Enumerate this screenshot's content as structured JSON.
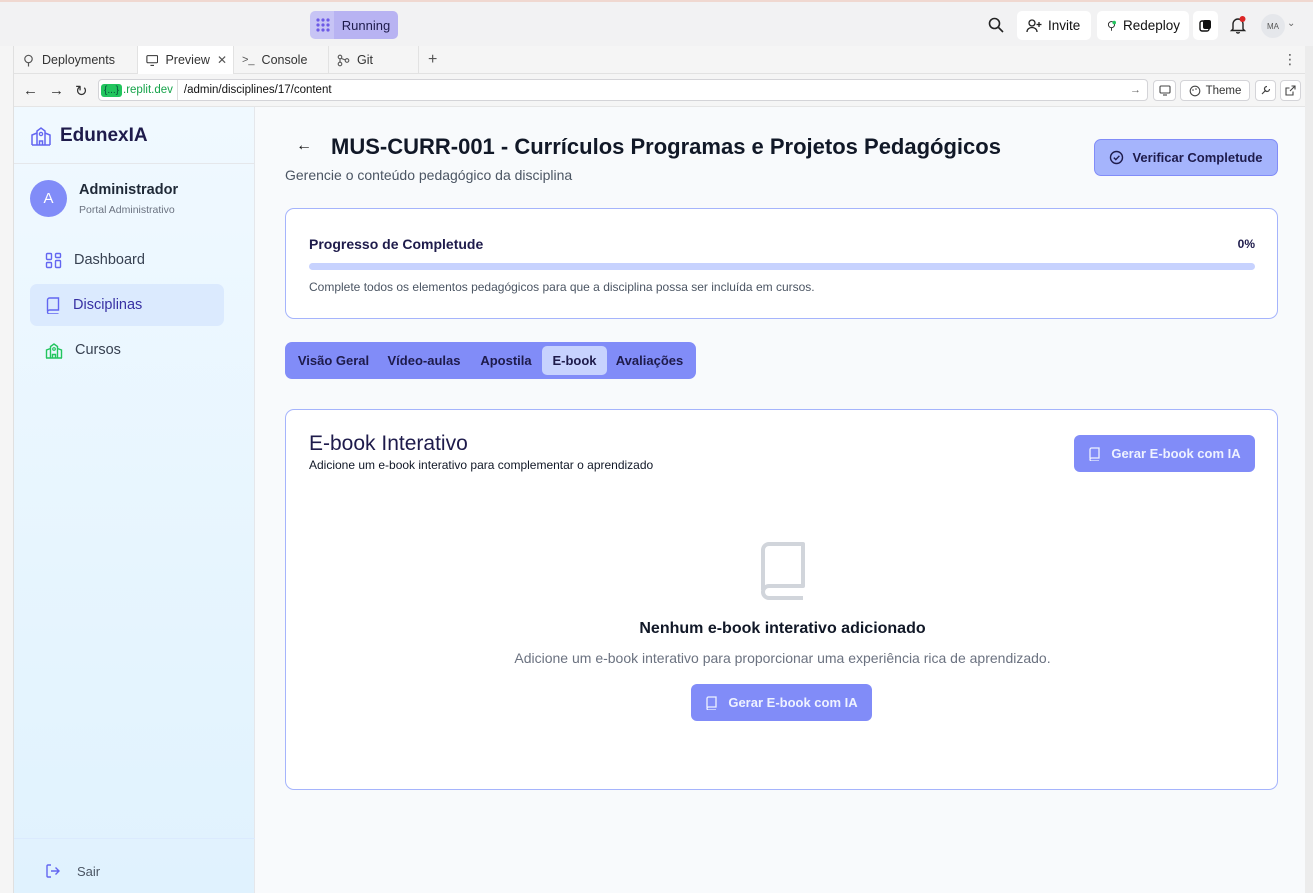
{
  "replit": {
    "run_label": "Running",
    "invite_label": "Invite",
    "redeploy_label": "Redeploy",
    "avatar_initials": "MA"
  },
  "tabs": [
    {
      "label": "Deployments"
    },
    {
      "label": "Preview"
    },
    {
      "label": "Console"
    },
    {
      "label": "Git"
    }
  ],
  "address": {
    "host_badge": "{...}",
    "host": ".replit.dev",
    "path": "/admin/disciplines/17/content",
    "theme_label": "Theme"
  },
  "sidebar": {
    "brand": "EdunexIA",
    "user_initial": "A",
    "user_name": "Administrador",
    "user_role": "Portal Administrativo",
    "items": [
      {
        "label": "Dashboard"
      },
      {
        "label": "Disciplinas"
      },
      {
        "label": "Cursos"
      }
    ],
    "logout_label": "Sair"
  },
  "page": {
    "title": "MUS-CURR-001 - Currículos Programas e Projetos Pedagógicos",
    "subtitle": "Gerencie o conteúdo pedagógico da disciplina",
    "verify_label": "Verificar Completude"
  },
  "progress": {
    "title": "Progresso de Completude",
    "percent_label": "0%",
    "value": 0,
    "note": "Complete todos os elementos pedagógicos para que a disciplina possa ser incluída em cursos."
  },
  "content_tabs": [
    {
      "label": "Visão Geral"
    },
    {
      "label": "Vídeo-aulas"
    },
    {
      "label": "Apostila"
    },
    {
      "label": "E-book"
    },
    {
      "label": "Avaliações"
    }
  ],
  "ebook": {
    "title": "E-book Interativo",
    "subtitle": "Adicione um e-book interativo para complementar o aprendizado",
    "generate_label": "Gerar E-book com IA",
    "empty_title": "Nenhum e-book interativo adicionado",
    "empty_desc": "Adicione um e-book interativo para proporcionar uma experiência rica de aprendizado."
  },
  "colors": {
    "accent": "#818cf8",
    "accent_light": "#c7d2fe",
    "sidebar_active": "#dbeafe"
  }
}
